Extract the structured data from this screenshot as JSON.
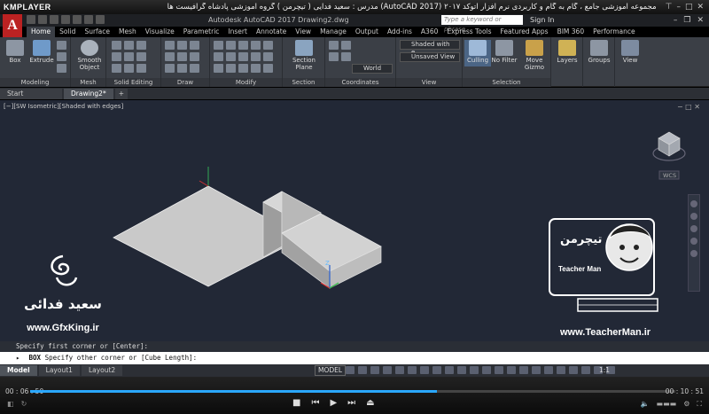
{
  "player": {
    "logo": "KMPLAYER",
    "title": "مجموعه آموزشی جامع ، گام به گام و کاربردی نرم افزار   اتوکد ۲۰۱۷ (AutoCAD 2017)   مدرس : سعید فدایی ( تیچرمن ) گروه آموزشی پادشاه گرافیست ها",
    "time_elapsed": "00 : 06 : 50",
    "time_total": "00 : 10 : 51",
    "progress": 0.63
  },
  "app": {
    "title": "Autodesk AutoCAD 2017    Drawing2.dwg",
    "search_placeholder": "Type a keyword or phrase",
    "signin": "Sign In"
  },
  "ribbon_tabs": [
    "Home",
    "Solid",
    "Surface",
    "Mesh",
    "Visualize",
    "Parametric",
    "Insert",
    "Annotate",
    "View",
    "Manage",
    "Output",
    "Add-ins",
    "A360",
    "Express Tools",
    "Featured Apps",
    "BIM 360",
    "Performance"
  ],
  "ribbon": {
    "groups": {
      "modeling": "Modeling",
      "mesh": "Mesh",
      "solid_editing": "Solid Editing",
      "draw": "Draw",
      "modify": "Modify",
      "section": "Section",
      "coordinates": "Coordinates",
      "view": "View",
      "selection": "Selection"
    },
    "buttons": {
      "box": "Box",
      "extrude": "Extrude",
      "smooth_object": "Smooth Object",
      "section_plane": "Section Plane",
      "culling": "Culling",
      "no_filter": "No Filter",
      "move_gizmo": "Move Gizmo",
      "layers": "Layers",
      "groups": "Groups",
      "view": "View"
    },
    "dropdowns": {
      "visual_style": "Shaded with e...",
      "view_state": "Unsaved View",
      "ucs": "World"
    }
  },
  "file_tabs": [
    "Start",
    "Drawing2*"
  ],
  "viewport": {
    "label": "[−][SW Isometric][Shaded with edges]",
    "viewcube_label": "WCS"
  },
  "watermarks": {
    "left_name": "سعید فدائی",
    "left_site": "www.GfxKing.ir",
    "right_site": "www.TeacherMan.ir",
    "right_logo_text": "تیچرمن",
    "right_logo_en": "Teacher Man"
  },
  "command": {
    "history": "Specify first corner or [Center]:",
    "prompt_prefix": "BOX",
    "prompt": "Specify other corner or [Cube Length]:"
  },
  "layout_tabs": [
    "Model",
    "Layout1",
    "Layout2"
  ],
  "status": {
    "model": "MODEL",
    "scale": "1:1"
  },
  "colors": {
    "viewport_bg": "#222836",
    "ribbon_bg": "#3b3f46",
    "accent": "#2aa7ff",
    "autocad_red": "#b22222"
  }
}
